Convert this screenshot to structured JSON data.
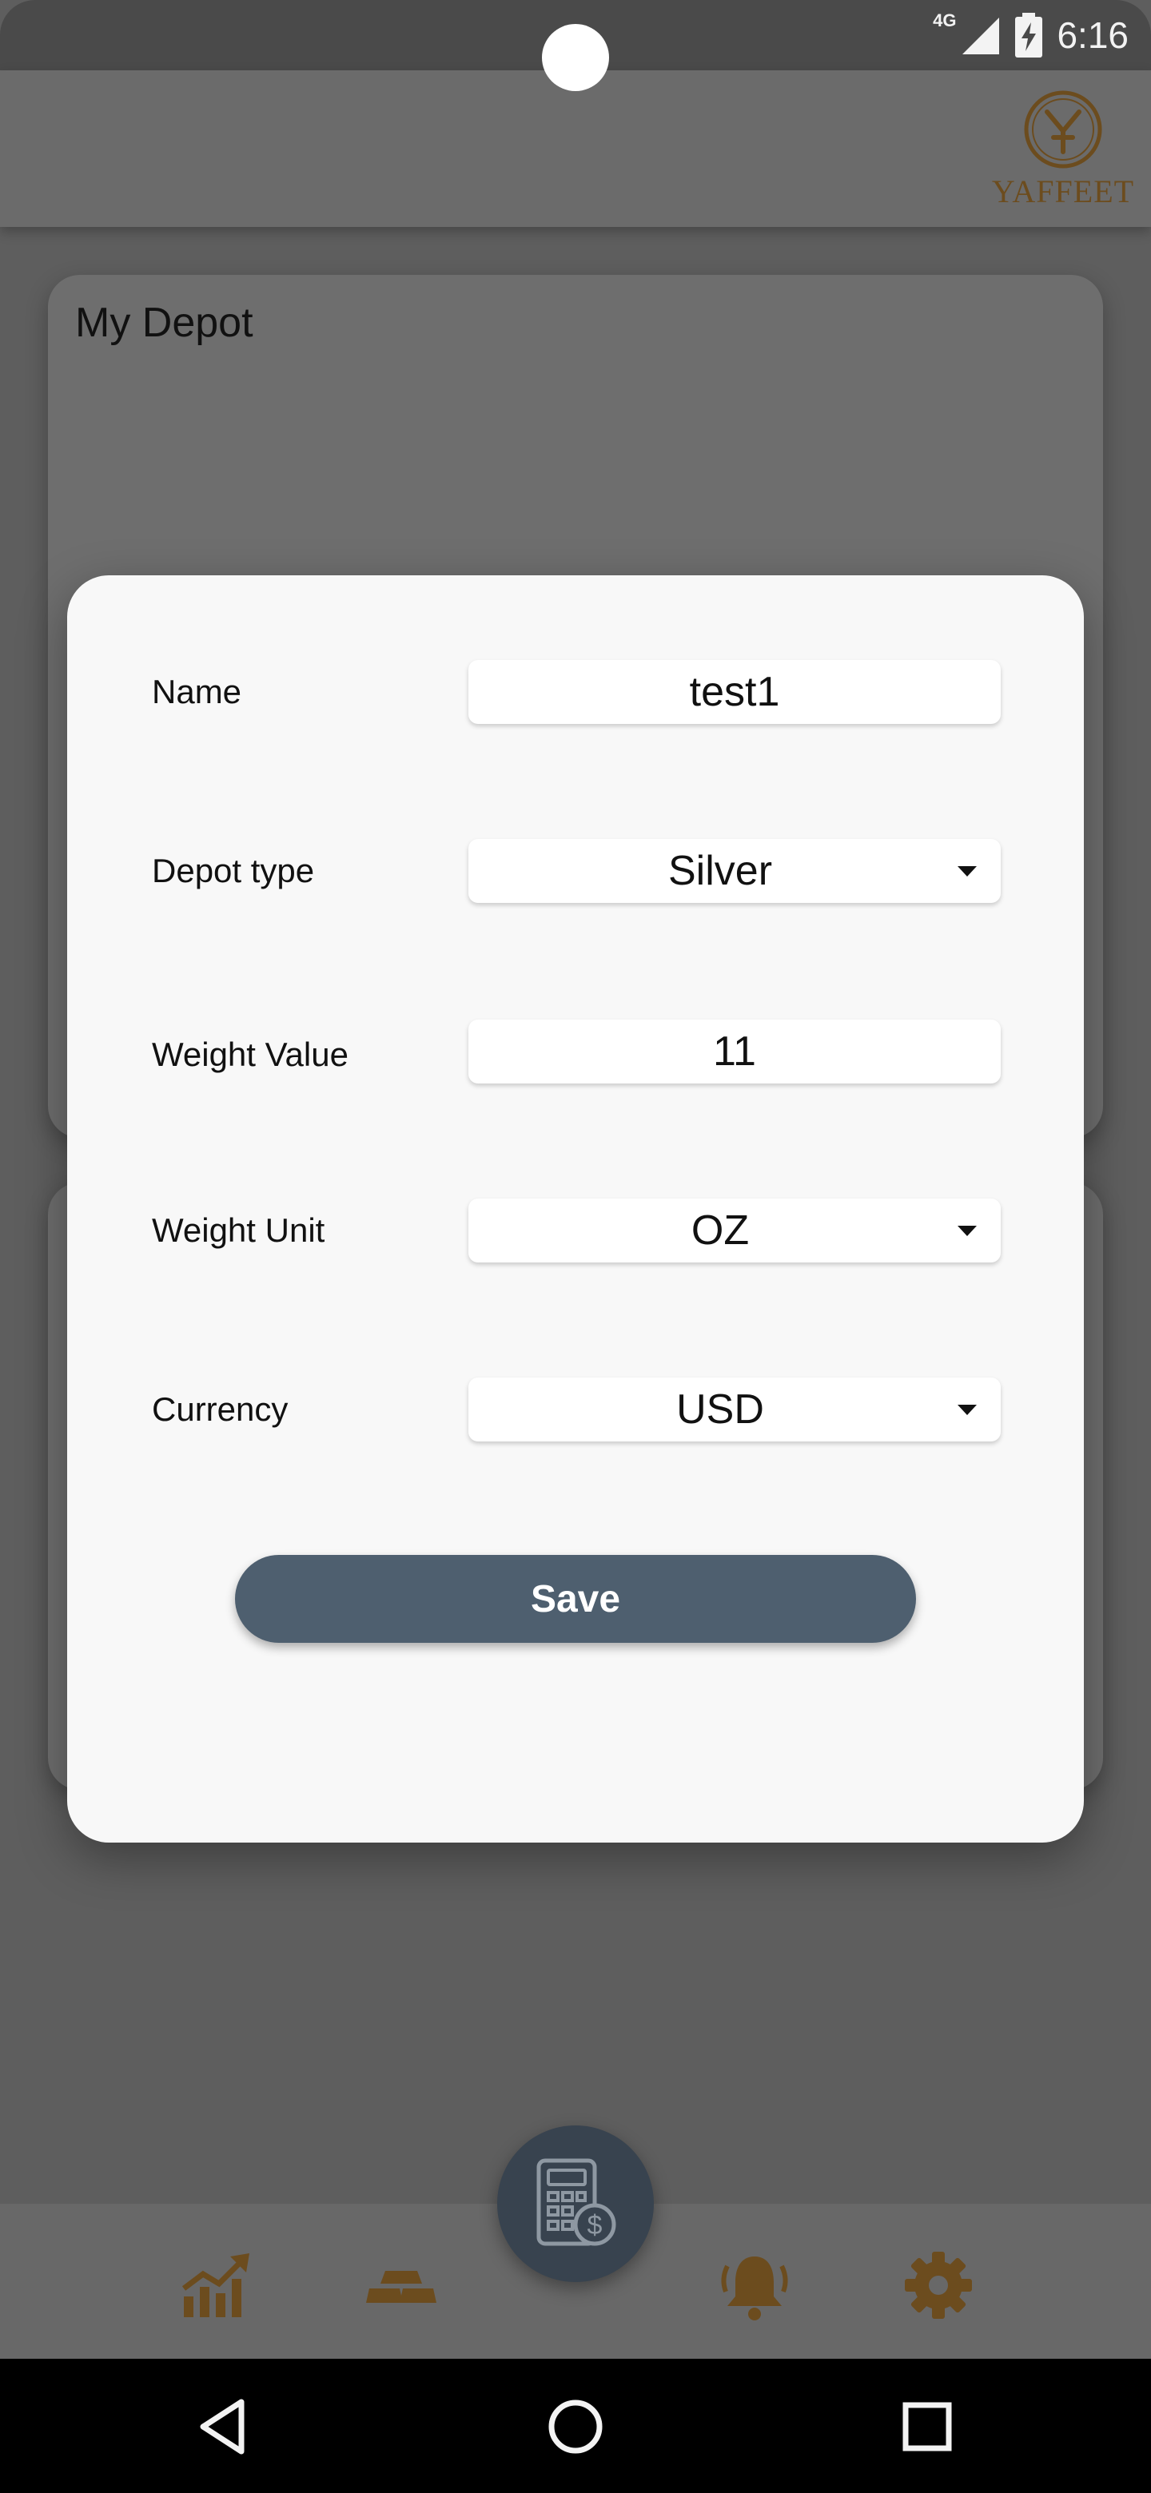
{
  "status_bar": {
    "network": "4G",
    "time": "6:16"
  },
  "app_bar": {
    "logo_text": "YAFFEET"
  },
  "depot_card": {
    "title": "My Depot"
  },
  "dialog": {
    "name": {
      "label": "Name",
      "value": "test1"
    },
    "depot_type": {
      "label": "Depot type",
      "value": "Silver"
    },
    "weight_value": {
      "label": "Weight Value",
      "value": "11"
    },
    "weight_unit": {
      "label": "Weight Unit",
      "value": "OZ"
    },
    "currency": {
      "label": "Currency",
      "value": "USD"
    },
    "save_label": "Save"
  },
  "bottom_nav": {
    "items": [
      "chart-icon",
      "gold-bars-icon",
      "calculator-icon",
      "bell-icon",
      "gear-icon"
    ]
  },
  "colors": {
    "accent_brown": "#6c4c1e",
    "save_button": "#4e5f6f",
    "fab": "#38434f"
  }
}
